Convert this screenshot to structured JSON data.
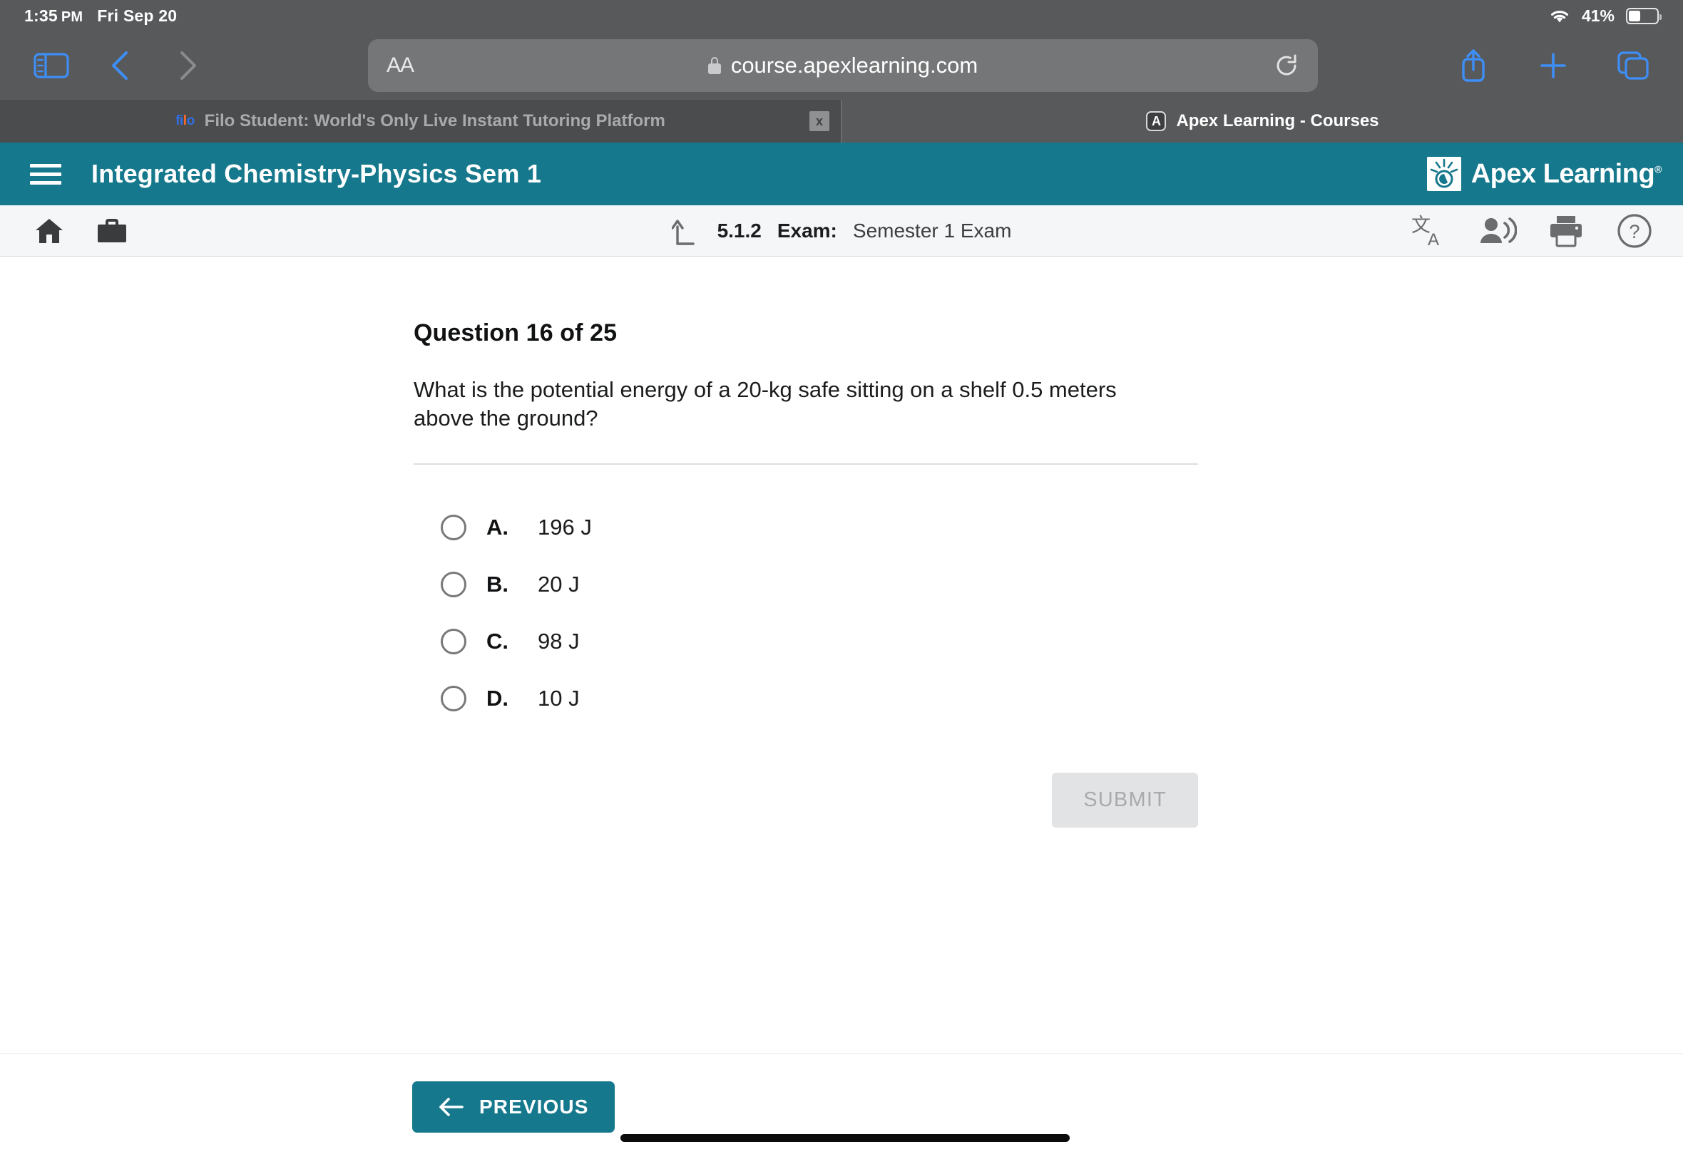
{
  "status_bar": {
    "time": "1:35",
    "meridiem": "PM",
    "date": "Fri Sep 20",
    "battery_percent": "41%",
    "wifi_icon": "wifi-icon",
    "battery_icon": "battery-icon"
  },
  "browser": {
    "sidebar_icon": "sidebar-icon",
    "back_icon": "chevron-left-icon",
    "forward_icon": "chevron-right-icon",
    "text_size_label": "AA",
    "lock_icon": "lock-icon",
    "url": "course.apexlearning.com",
    "reload_icon": "reload-icon",
    "share_icon": "share-icon",
    "new_tab_icon": "plus-icon",
    "tabs_overview_icon": "tabs-icon",
    "tabs": [
      {
        "favicon": "filo-favicon",
        "favicon_text_a": "fi",
        "favicon_text_b": "l",
        "favicon_text_c": "o",
        "title": "Filo Student: World's Only Live Instant Tutoring Platform",
        "active": false,
        "close_label": "x"
      },
      {
        "favicon": "apex-favicon",
        "favicon_letter": "A",
        "title": "Apex Learning - Courses",
        "active": true
      }
    ]
  },
  "app_header": {
    "menu_icon": "list-menu-icon",
    "course_title": "Integrated Chemistry-Physics Sem 1",
    "logo_text": "Apex Learning",
    "logo_trademark": "®",
    "background_color": "#16788c"
  },
  "activity_bar": {
    "home_icon": "home-icon",
    "briefcase_icon": "briefcase-icon",
    "up_arrow_icon": "up-level-icon",
    "crumb_number": "5.1.2",
    "crumb_kind": "Exam:",
    "crumb_name": "Semester 1 Exam",
    "tools": [
      {
        "icon": "translate-icon",
        "name": "translate"
      },
      {
        "icon": "read-aloud-icon",
        "name": "read-aloud"
      },
      {
        "icon": "print-icon",
        "name": "print"
      },
      {
        "icon": "help-icon",
        "name": "help"
      }
    ]
  },
  "question": {
    "heading": "Question 16 of 25",
    "number": 16,
    "total": 25,
    "text": "What is the potential energy of a 20-kg safe sitting on a shelf 0.5 meters above the ground?",
    "options": [
      {
        "letter": "A.",
        "value": "196 J",
        "selected": false
      },
      {
        "letter": "B.",
        "value": "20 J",
        "selected": false
      },
      {
        "letter": "C.",
        "value": "98 J",
        "selected": false
      },
      {
        "letter": "D.",
        "value": "10 J",
        "selected": false
      }
    ],
    "submit_label": "SUBMIT",
    "submit_enabled": false
  },
  "footer": {
    "previous_label": "PREVIOUS",
    "previous_arrow_icon": "arrow-left-icon",
    "accent_color": "#16788c"
  }
}
